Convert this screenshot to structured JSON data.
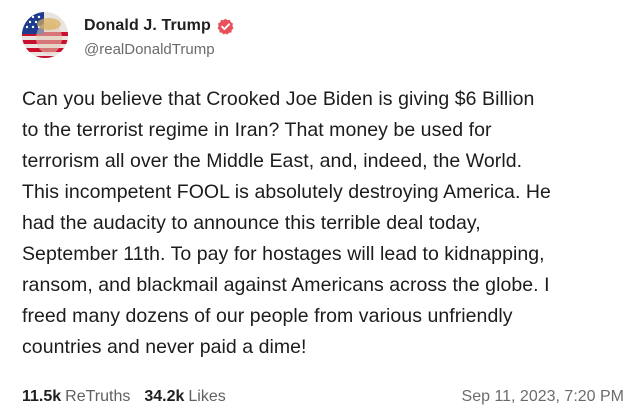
{
  "author": {
    "display_name": "Donald J. Trump",
    "handle": "@realDonaldTrump",
    "avatar_icon": "flag-face-avatar",
    "verified_icon": "verified-badge-icon",
    "verified_color": "#e8505b"
  },
  "post": {
    "lines": [
      "Can you believe that Crooked Joe Biden is giving $6 Billion",
      "to the terrorist regime in Iran? That money be used for",
      "terrorism all over the Middle East, and, indeed, the World.",
      "This incompetent FOOL is absolutely destroying America. He",
      "had the audacity to announce this terrible deal today,",
      "September 11th. To pay for hostages will lead to kidnapping,",
      "ransom, and blackmail against Americans across the globe. I",
      "freed many dozens of our people from various unfriendly",
      "countries and never paid a dime!"
    ]
  },
  "stats": {
    "retruths_count": "11.5k",
    "retruths_label": "ReTruths",
    "likes_count": "34.2k",
    "likes_label": "Likes"
  },
  "timestamp": "Sep 11, 2023, 7:20 PM"
}
